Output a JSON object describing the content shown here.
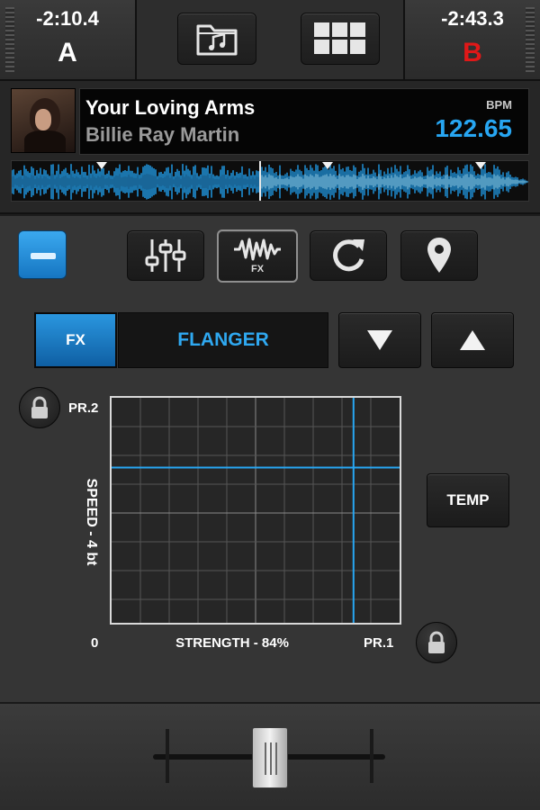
{
  "deck_a": {
    "time": "-2:10.4",
    "letter": "A"
  },
  "deck_b": {
    "time": "-2:43.3",
    "letter": "B",
    "letter_color": "#e01818"
  },
  "toolbar": {
    "library_icon": "music-folder-icon",
    "grid_icon": "grid-icon"
  },
  "track": {
    "title": "Your Loving Arms",
    "artist": "Billie Ray Martin",
    "bpm_label": "BPM",
    "bpm": "122.65",
    "accent_color": "#27a6f2"
  },
  "modes": {
    "collapse_icon": "minus-icon",
    "items": [
      {
        "name": "mixer",
        "icon": "sliders-icon"
      },
      {
        "name": "fx",
        "icon": "waveform-icon",
        "label": "FX",
        "active": true
      },
      {
        "name": "loop",
        "icon": "loop-icon"
      },
      {
        "name": "cue",
        "icon": "map-pin-icon"
      }
    ]
  },
  "fx": {
    "toggle_label": "FX",
    "effect_name": "FLANGER",
    "prev_icon": "triangle-down-icon",
    "next_icon": "triangle-up-icon"
  },
  "xy_pad": {
    "y_label": "SPEED - 4 bt",
    "top_label": "PR.2",
    "origin_label": "0",
    "x_label": "STRENGTH - 84%",
    "right_label": "PR.1",
    "strength": 0.84,
    "speed": 0.69,
    "line_color": "#27a6f2"
  },
  "temp": {
    "label": "TEMP"
  },
  "crossfader": {
    "position": 0.5
  }
}
